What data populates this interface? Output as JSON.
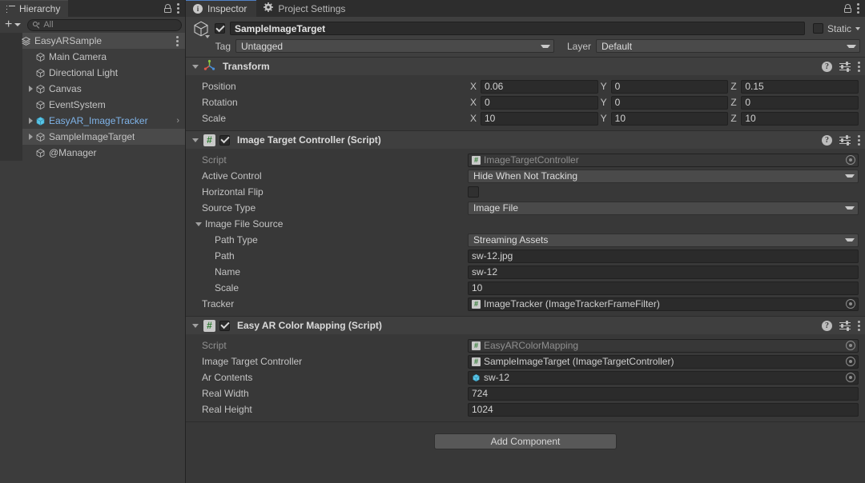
{
  "hierarchy": {
    "tab_label": "Hierarchy",
    "tab_icon": "hierarchy-list-icon",
    "lock_icon": "lock-open-icon",
    "menu_icon": "kebab-menu-icon",
    "toolbar": {
      "add_label": "+",
      "search_placeholder": "All",
      "search_icon": "search-icon"
    },
    "items": [
      {
        "label": "EasyARSample",
        "depth": 0,
        "twirl": "down",
        "icon": "scene-icon",
        "selected": false,
        "highlight": true,
        "prefab": false,
        "has_menu": true
      },
      {
        "label": "Main Camera",
        "depth": 1,
        "twirl": "none",
        "icon": "gameobject-cube-icon",
        "selected": false,
        "highlight": false,
        "prefab": false,
        "has_menu": false
      },
      {
        "label": "Directional Light",
        "depth": 1,
        "twirl": "none",
        "icon": "gameobject-cube-icon",
        "selected": false,
        "highlight": false,
        "prefab": false,
        "has_menu": false
      },
      {
        "label": "Canvas",
        "depth": 1,
        "twirl": "right",
        "icon": "gameobject-cube-icon",
        "selected": false,
        "highlight": false,
        "prefab": false,
        "has_menu": false
      },
      {
        "label": "EventSystem",
        "depth": 1,
        "twirl": "none",
        "icon": "gameobject-cube-icon",
        "selected": false,
        "highlight": false,
        "prefab": false,
        "has_menu": false
      },
      {
        "label": "EasyAR_ImageTracker",
        "depth": 1,
        "twirl": "right",
        "icon": "prefab-cube-icon",
        "selected": false,
        "highlight": false,
        "prefab": true,
        "has_menu": false,
        "chevron": "›"
      },
      {
        "label": "SampleImageTarget",
        "depth": 1,
        "twirl": "right",
        "icon": "gameobject-cube-icon",
        "selected": true,
        "highlight": false,
        "prefab": false,
        "has_menu": false
      },
      {
        "label": "@Manager",
        "depth": 1,
        "twirl": "none",
        "icon": "gameobject-cube-icon",
        "selected": false,
        "highlight": false,
        "prefab": false,
        "has_menu": false
      }
    ]
  },
  "inspector": {
    "tabs": [
      {
        "label": "Inspector",
        "icon": "info-icon",
        "active": true
      },
      {
        "label": "Project Settings",
        "icon": "gear-icon",
        "active": false
      }
    ],
    "lock_icon": "lock-open-icon",
    "menu_icon": "kebab-menu-icon",
    "object_header": {
      "icon": "gameobject-cube-icon",
      "enabled": true,
      "name": "SampleImageTarget",
      "static_label": "Static",
      "static_checked": false,
      "tag_label": "Tag",
      "tag_value": "Untagged",
      "layer_label": "Layer",
      "layer_value": "Default"
    },
    "components": [
      {
        "id": "transform",
        "title": "Transform",
        "icon": "transform-gizmo-icon",
        "has_checkbox": false,
        "expanded": true,
        "help_icon": "help-icon",
        "preset_icon": "preset-sliders-icon",
        "menu_icon": "kebab-menu-icon",
        "vectors": [
          {
            "label": "Position",
            "x": "0.06",
            "y": "0",
            "z": "0.15"
          },
          {
            "label": "Rotation",
            "x": "0",
            "y": "0",
            "z": "0"
          },
          {
            "label": "Scale",
            "x": "10",
            "y": "10",
            "z": "10"
          }
        ],
        "axis_labels": {
          "x": "X",
          "y": "Y",
          "z": "Z"
        }
      },
      {
        "id": "image-target-controller",
        "title": "Image Target Controller (Script)",
        "icon": "cs-script-icon",
        "icon_glyph": "#",
        "has_checkbox": true,
        "checked": true,
        "expanded": true,
        "help_icon": "help-icon",
        "preset_icon": "preset-sliders-icon",
        "menu_icon": "kebab-menu-icon",
        "fields": [
          {
            "kind": "object-readonly",
            "label": "Script",
            "value": "ImageTargetController",
            "icon": "cs-script-icon",
            "indent": 0
          },
          {
            "kind": "dropdown",
            "label": "Active Control",
            "value": "Hide When Not Tracking",
            "indent": 0
          },
          {
            "kind": "checkbox",
            "label": "Horizontal Flip",
            "checked": false,
            "indent": 0
          },
          {
            "kind": "dropdown",
            "label": "Source Type",
            "value": "Image File",
            "indent": 0
          },
          {
            "kind": "foldout",
            "label": "Image File Source",
            "indent": 0
          },
          {
            "kind": "dropdown",
            "label": "Path Type",
            "value": "Streaming Assets",
            "indent": 1
          },
          {
            "kind": "text",
            "label": "Path",
            "value": "sw-12.jpg",
            "indent": 1
          },
          {
            "kind": "text",
            "label": "Name",
            "value": "sw-12",
            "indent": 1
          },
          {
            "kind": "text",
            "label": "Scale",
            "value": "10",
            "indent": 1
          },
          {
            "kind": "object",
            "label": "Tracker",
            "value": "ImageTracker (ImageTrackerFrameFilter)",
            "icon": "cs-script-icon",
            "indent": 0
          }
        ]
      },
      {
        "id": "easy-ar-color-mapping",
        "title": "Easy AR Color Mapping (Script)",
        "icon": "cs-script-icon",
        "icon_glyph": "#",
        "has_checkbox": true,
        "checked": true,
        "expanded": true,
        "help_icon": "help-icon",
        "preset_icon": "preset-sliders-icon",
        "menu_icon": "kebab-menu-icon",
        "fields": [
          {
            "kind": "object-readonly",
            "label": "Script",
            "value": "EasyARColorMapping",
            "icon": "cs-script-icon",
            "indent": 0
          },
          {
            "kind": "object",
            "label": "Image Target Controller",
            "value": "SampleImageTarget (ImageTargetController)",
            "icon": "cs-script-icon",
            "indent": 0
          },
          {
            "kind": "object",
            "label": "Ar Contents",
            "value": "sw-12",
            "icon": "prefab-cube-icon",
            "indent": 0
          },
          {
            "kind": "text",
            "label": "Real Width",
            "value": "724",
            "indent": 0
          },
          {
            "kind": "text",
            "label": "Real Height",
            "value": "1024",
            "indent": 0
          }
        ]
      }
    ],
    "add_component_label": "Add Component"
  },
  "colors": {
    "window_bg": "#383838",
    "panel_bg": "#3c3c3c",
    "tabbar_bg": "#2d2d2d",
    "component_header": "#3f3f3f",
    "field_bg": "#2b2b2b",
    "dropdown_bg": "#4a4a4a",
    "selection": "#4a4a4a",
    "prefab_blue": "#7fb3e8",
    "active_tab_accent": "#4f7fc4",
    "script_green": "#2f7d32",
    "text": "#c4c4c4"
  }
}
